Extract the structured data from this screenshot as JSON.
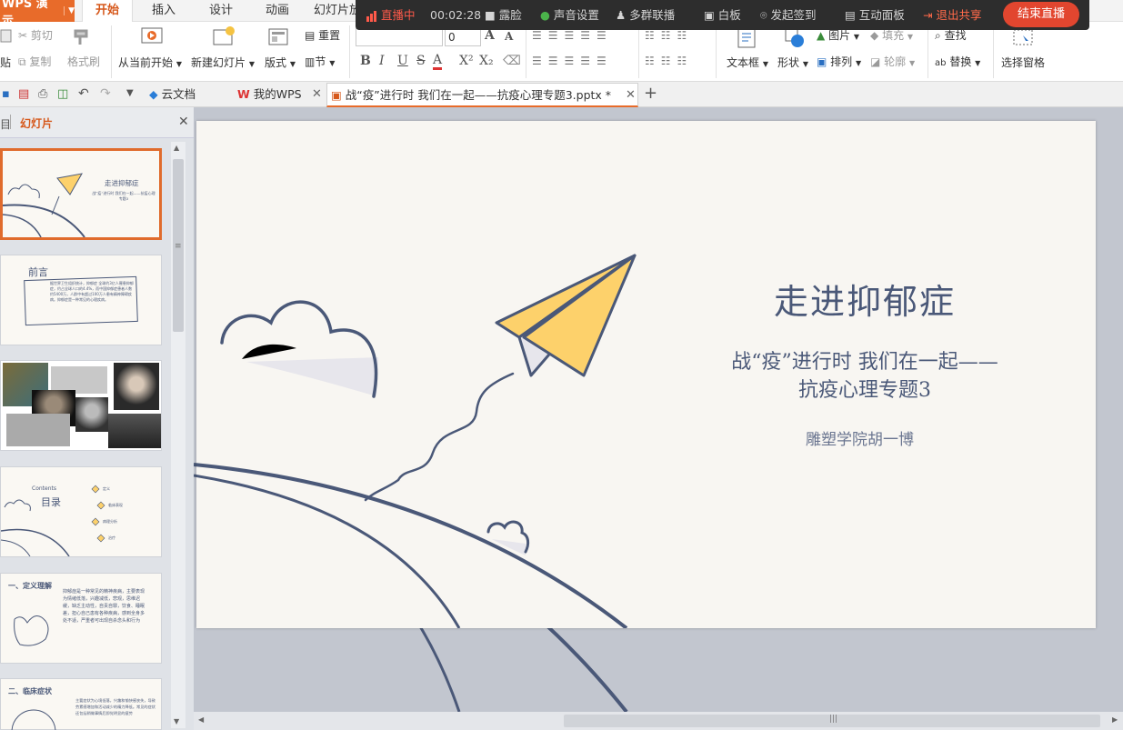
{
  "app": {
    "name": "WPS 演示",
    "dropdown_icon": "chevron-down-icon"
  },
  "ribbon_tabs": [
    "开始",
    "插入",
    "设计",
    "动画",
    "幻灯片放"
  ],
  "ribbon": {
    "cut": "剪切",
    "copy": "复制",
    "format_painter": "格式刷",
    "paste_partial": "贴",
    "from_current": "从当前开始",
    "new_slide": "新建幻灯片",
    "layout": "版式",
    "reset": "重置",
    "section": "节",
    "font_size": "0",
    "textbox": "文本框",
    "shape": "形状",
    "picture": "图片",
    "fill": "填充",
    "arrange": "排列",
    "outline": "轮廓",
    "find": "查找",
    "replace": "替换",
    "selection_pane": "选择窗格"
  },
  "live": {
    "status": "直播中",
    "time": "00:02:28",
    "camera": "露脸",
    "audio": "声音设置",
    "multi_group": "多群联播",
    "whiteboard": "白板",
    "checkin": "发起签到",
    "interactive": "互动面板",
    "exit_share": "退出共享",
    "end_live": "结束直播"
  },
  "doc_tabs": [
    {
      "label": "云文档"
    },
    {
      "label": "我的WPS"
    },
    {
      "label": "战“疫”进行时 我们在一起——抗疫心理专题3.pptx *"
    }
  ],
  "left_panel": {
    "tab_outline": "目",
    "tab_slides": "幻灯片"
  },
  "thumbnails": [
    {
      "title": "走进抑郁症",
      "sub": "战“疫”进行时 我们在一起——抗疫心理专题3"
    },
    {
      "title": "前言",
      "body": "据世界卫生组织统计，抑郁症 全球约3亿人罹患抑郁症，约占全球人口的4.4%，而中国抑郁症患者人数约5400万，人群中有超过100万人患有精神障碍疾病。抑郁症是一种常见的心理疾病。"
    },
    {
      "title": ""
    },
    {
      "title": "目录",
      "sub": "Contents",
      "items": [
        "定义",
        "临床表现",
        "病理分析",
        "治疗"
      ]
    },
    {
      "title": "一、定义理解",
      "body": "抑郁症是一种常见的精神疾病，主要表现为情绪低落，兴趣减低，悲观，思维迟缓，缺乏主动性，自责自罪，饮食、睡眠差，担心自己患有各种疾病，感到全身多处不适，严重者可出现自杀念头和行为"
    },
    {
      "title": "二、临床症状",
      "body": "主要症状为心境低落，兴趣和愉快感丧失，导致劳累感增加和活动减少的精力降低。常见的症状还包括稍做事情后即觉明显的疲劳"
    }
  ],
  "slide": {
    "title": "走进抑郁症",
    "subtitle_line1": "战“疫”进行时  我们在一起——",
    "subtitle_line2": "抗疫心理专题3",
    "author": "雕塑学院胡一博"
  },
  "colors": {
    "accent": "#e86b2a",
    "navy": "#4a5878",
    "yellow": "#fdd16b",
    "live_red": "#e2462f"
  }
}
